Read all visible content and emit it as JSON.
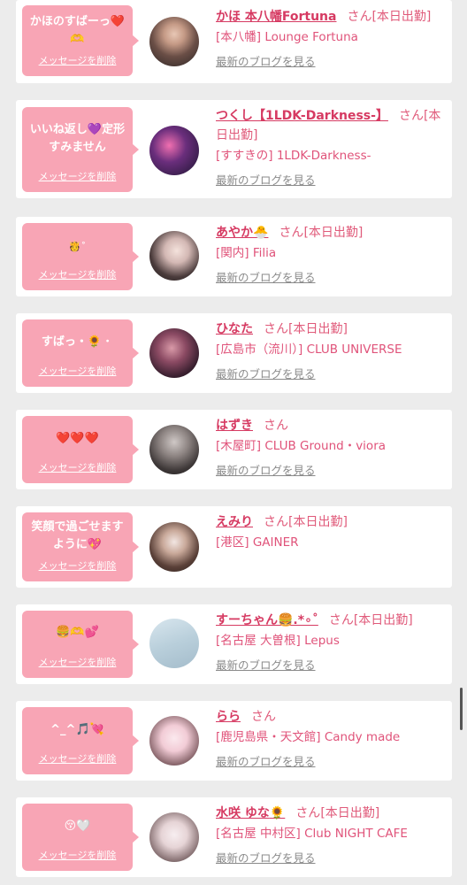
{
  "delete_label": "メッセージを削除",
  "blog_label": "最新のブログを見る",
  "san": "さん",
  "cards": [
    {
      "message": "かほのすばーっ",
      "emoji": "❤️🫶",
      "name": "かほ 本八幡Fortuna",
      "status": "[本日出勤]",
      "shop": "[本八幡] Lounge Fortuna"
    },
    {
      "message": "いいね返し💜定形すみません",
      "emoji": "",
      "name": "つくし【1LDK-Darkness-】",
      "status": "[本日出勤]",
      "shop": "[すすきの] 1LDK-Darkness-"
    },
    {
      "message": "",
      "emoji": "🫅˚",
      "name": "あやか",
      "name_emoji": "🐣",
      "status": "[本日出勤]",
      "shop": "[関内] Filia"
    },
    {
      "message": "すばっ・",
      "emoji": "🌻・",
      "name": "ひなた",
      "status": "[本日出勤]",
      "shop": "[広島市（流川）] CLUB UNIVERSE"
    },
    {
      "message": "",
      "emoji": "❤️❤️❤️",
      "name": "はずき",
      "status": "",
      "shop": "[木屋町] CLUB Ground・viora"
    },
    {
      "message": "笑顔で過ごせますように",
      "emoji": "💖",
      "name": "えみり",
      "status": "[本日出勤]",
      "shop": "[港区] GAINER"
    },
    {
      "message": "",
      "emoji": "🍔🫶💕",
      "name": "すーちゃん🍔.*∘˚",
      "status": "[本日出勤]",
      "shop": "[名古屋 大曽根] Lepus"
    },
    {
      "message": "^⁠_⁠^",
      "emoji": "🎵💘",
      "name": "らら",
      "status": "",
      "shop": "[鹿児島県・天文館] Candy made"
    },
    {
      "message": "",
      "emoji": "😚🤍",
      "name": "水咲 ゆな",
      "name_emoji": "🌻",
      "status": "[本日出勤]",
      "shop": "[名古屋 中村区] Club NIGHT CAFE"
    }
  ],
  "colors": {
    "bubble": "#f8a5b5",
    "name": "#d63a62",
    "shop": "#e0537a",
    "background": "#ececec"
  }
}
